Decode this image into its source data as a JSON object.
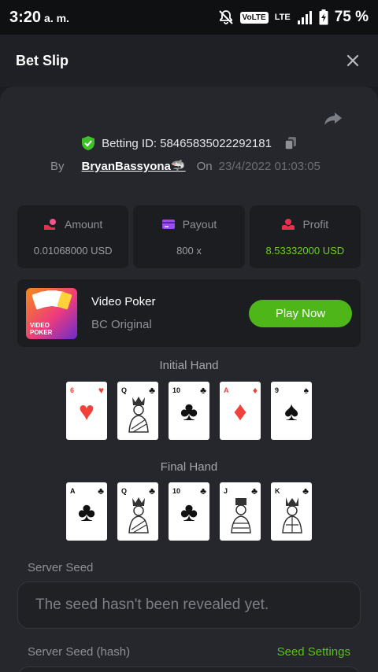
{
  "status_bar": {
    "time": "3:20",
    "ampm": "a. m.",
    "volte": "VoLTE",
    "lte": "LTE",
    "battery": "75 %"
  },
  "header": {
    "title": "Bet Slip"
  },
  "bet": {
    "betting_id_label": "Betting ID:",
    "betting_id": "58465835022292181",
    "by_label": "By",
    "username": "BryanBassyona🦈",
    "on_label": "On",
    "date": "23/4/2022 01:03:05"
  },
  "stats": [
    {
      "label": "Amount",
      "value": "0.01068000 USD",
      "icon": "coins-hand-icon"
    },
    {
      "label": "Payout",
      "value": "800 x",
      "icon": "wallet-card-icon"
    },
    {
      "label": "Profit",
      "value": "8.53332000 USD",
      "icon": "hand-money-icon"
    }
  ],
  "game": {
    "name": "Video Poker",
    "subtitle": "BC Original",
    "thumb_text": "VIDEO POKER",
    "play_label": "Play Now"
  },
  "initial_hand": {
    "label": "Initial Hand",
    "cards": [
      {
        "rank": "6",
        "suit": "♥",
        "color": "red"
      },
      {
        "rank": "Q",
        "suit": "♣",
        "color": "black"
      },
      {
        "rank": "10",
        "suit": "♣",
        "color": "black"
      },
      {
        "rank": "A",
        "suit": "♦",
        "color": "red"
      },
      {
        "rank": "9",
        "suit": "♠",
        "color": "black"
      }
    ]
  },
  "final_hand": {
    "label": "Final Hand",
    "cards": [
      {
        "rank": "A",
        "suit": "♣",
        "color": "black"
      },
      {
        "rank": "Q",
        "suit": "♣",
        "color": "black"
      },
      {
        "rank": "10",
        "suit": "♣",
        "color": "black"
      },
      {
        "rank": "J",
        "suit": "♣",
        "color": "black"
      },
      {
        "rank": "K",
        "suit": "♣",
        "color": "black"
      }
    ]
  },
  "server_seed": {
    "label": "Server Seed",
    "value": "The seed hasn't been revealed yet."
  },
  "server_seed_hash": {
    "label": "Server Seed (hash)",
    "settings_label": "Seed Settings"
  },
  "colors": {
    "accent_green": "#4fb61a",
    "profit_green": "#6ccf1e",
    "card_red": "#f0413a"
  }
}
